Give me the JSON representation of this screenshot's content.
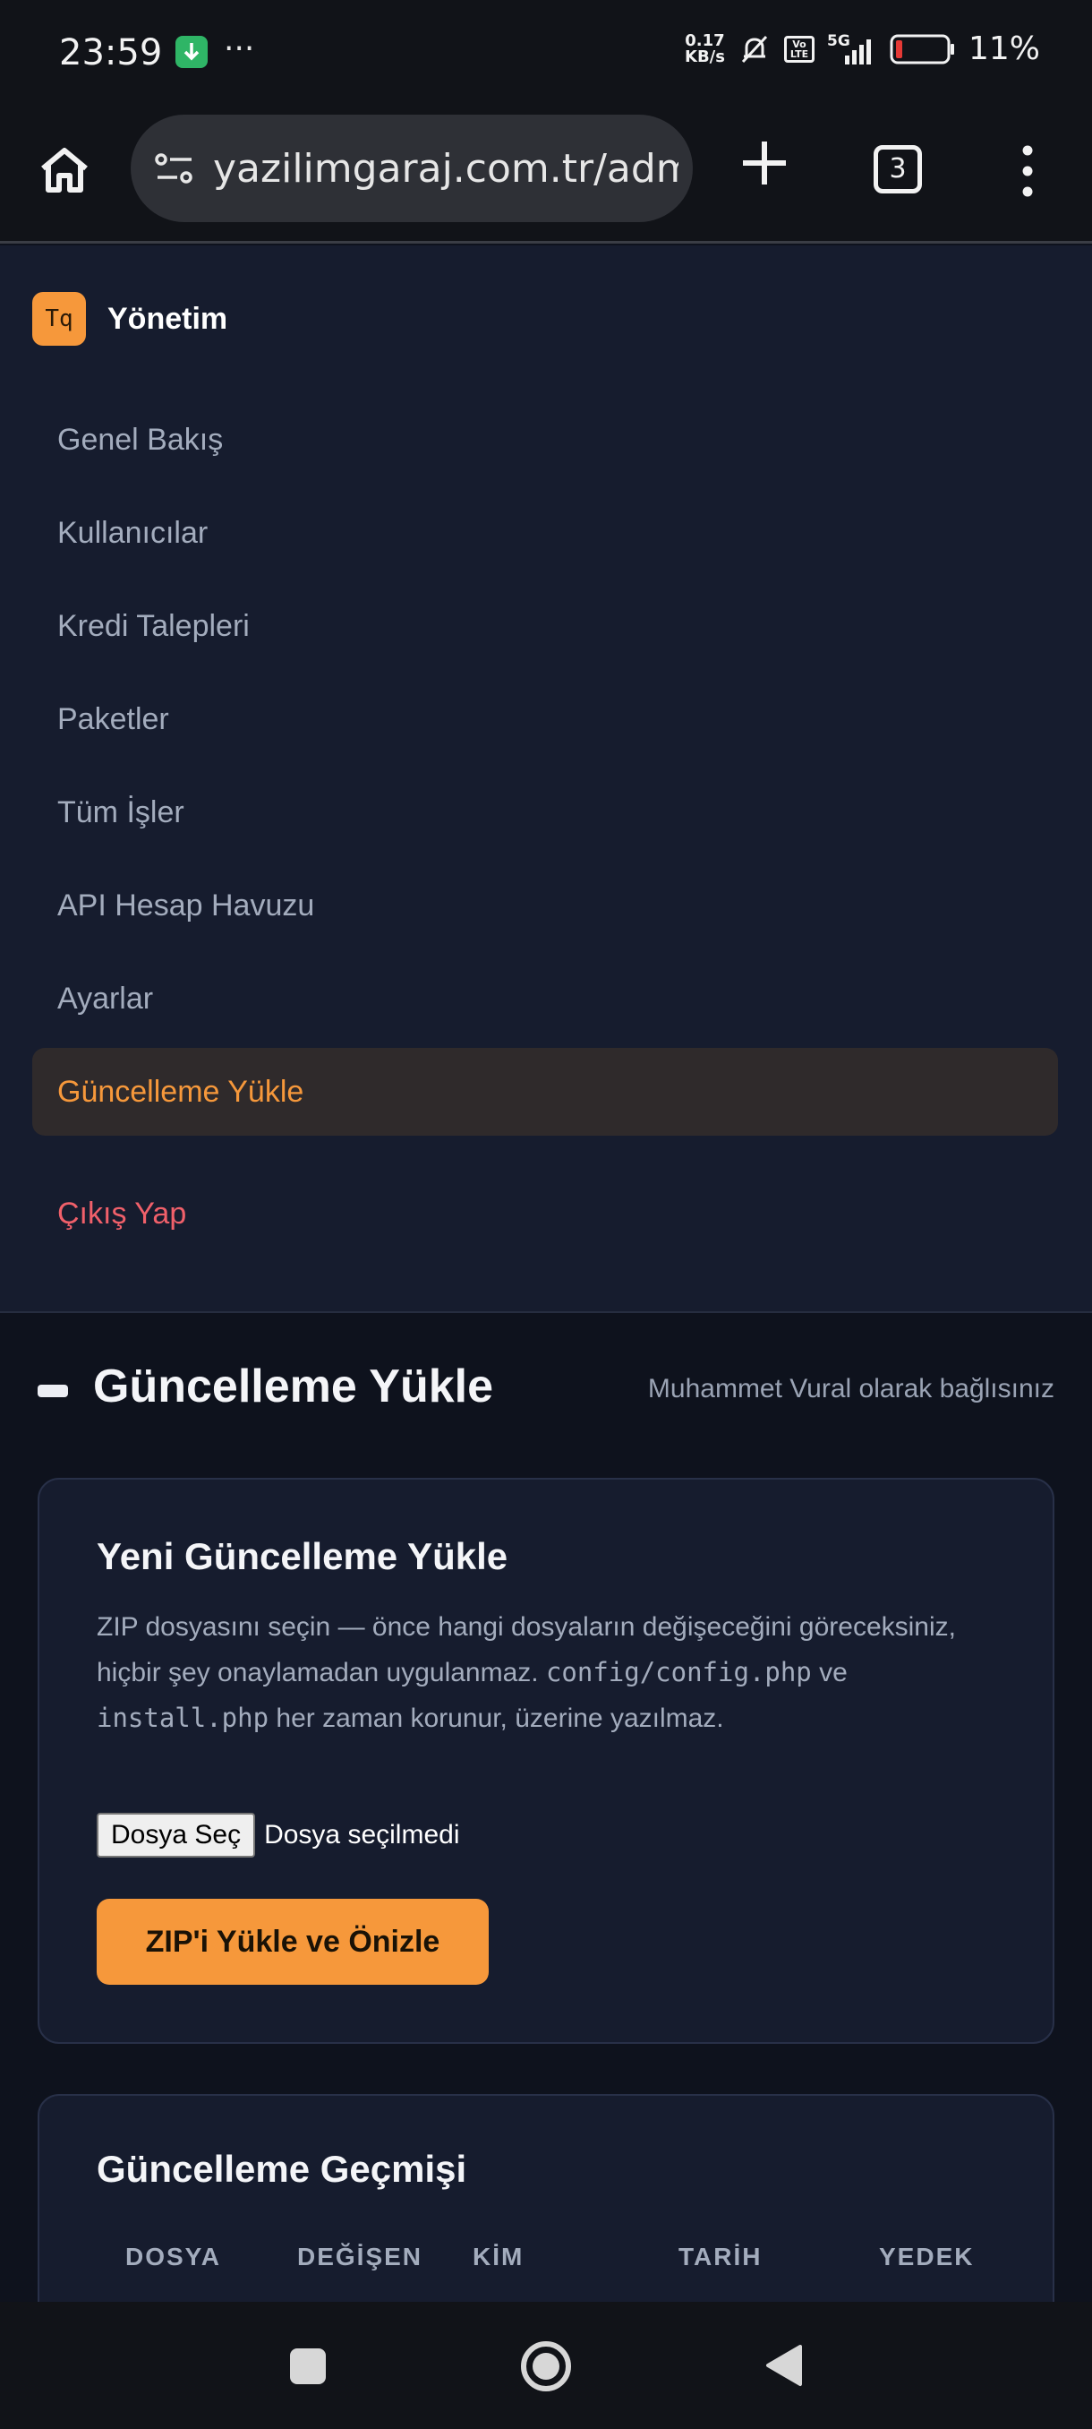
{
  "status_bar": {
    "time": "23:59",
    "more": "···",
    "speed_value": "0.17",
    "speed_unit": "KB/s",
    "network": "5G",
    "volte": "Vo LTE",
    "battery_percent": "11%",
    "icons": [
      "download-icon",
      "mute-bell-icon",
      "volte-icon",
      "signal-icon",
      "battery-icon"
    ]
  },
  "browser": {
    "url": "yazilimgaraj.com.tr/adm",
    "tab_count": "3",
    "icons": [
      "home-icon",
      "site-settings-icon",
      "new-tab-icon",
      "tabs-icon",
      "menu-icon"
    ]
  },
  "sidebar": {
    "logo_text": "Tq",
    "brand": "Yönetim",
    "items": [
      {
        "label": "Genel Bakış",
        "active": false
      },
      {
        "label": "Kullanıcılar",
        "active": false
      },
      {
        "label": "Kredi Talepleri",
        "active": false
      },
      {
        "label": "Paketler",
        "active": false
      },
      {
        "label": "Tüm İşler",
        "active": false
      },
      {
        "label": "API Hesap Havuzu",
        "active": false
      },
      {
        "label": "Ayarlar",
        "active": false
      },
      {
        "label": "Güncelleme Yükle",
        "active": true
      }
    ],
    "logout": "Çıkış Yap"
  },
  "header": {
    "title": "Güncelleme Yükle",
    "connected_as": "Muhammet Vural olarak bağlısınız"
  },
  "upload_card": {
    "title": "Yeni Güncelleme Yükle",
    "desc_part1": "ZIP dosyasını seçin — önce hangi dosyaların değişeceğini göreceksiniz, hiçbir şey onaylamadan uygulanmaz.",
    "desc_code1": "config/config.php",
    "desc_and": "ve",
    "desc_code2": "install.php",
    "desc_part2": "her zaman korunur, üzerine yazılmaz.",
    "file_button": "Dosya Seç",
    "file_status": "Dosya seçilmedi",
    "submit_label": "ZIP'i Yükle ve Önizle"
  },
  "history_card": {
    "title": "Güncelleme Geçmişi",
    "columns": [
      "DOSYA",
      "DEĞİŞEN",
      "KİM",
      "TARİH",
      "YEDEK"
    ]
  },
  "colors": {
    "accent": "#f6983b",
    "danger": "#f0606a",
    "panel": "#161c2e",
    "background": "#0e121d"
  },
  "android_nav": {
    "icons": [
      "recents-icon",
      "home-circle-icon",
      "back-icon"
    ]
  }
}
